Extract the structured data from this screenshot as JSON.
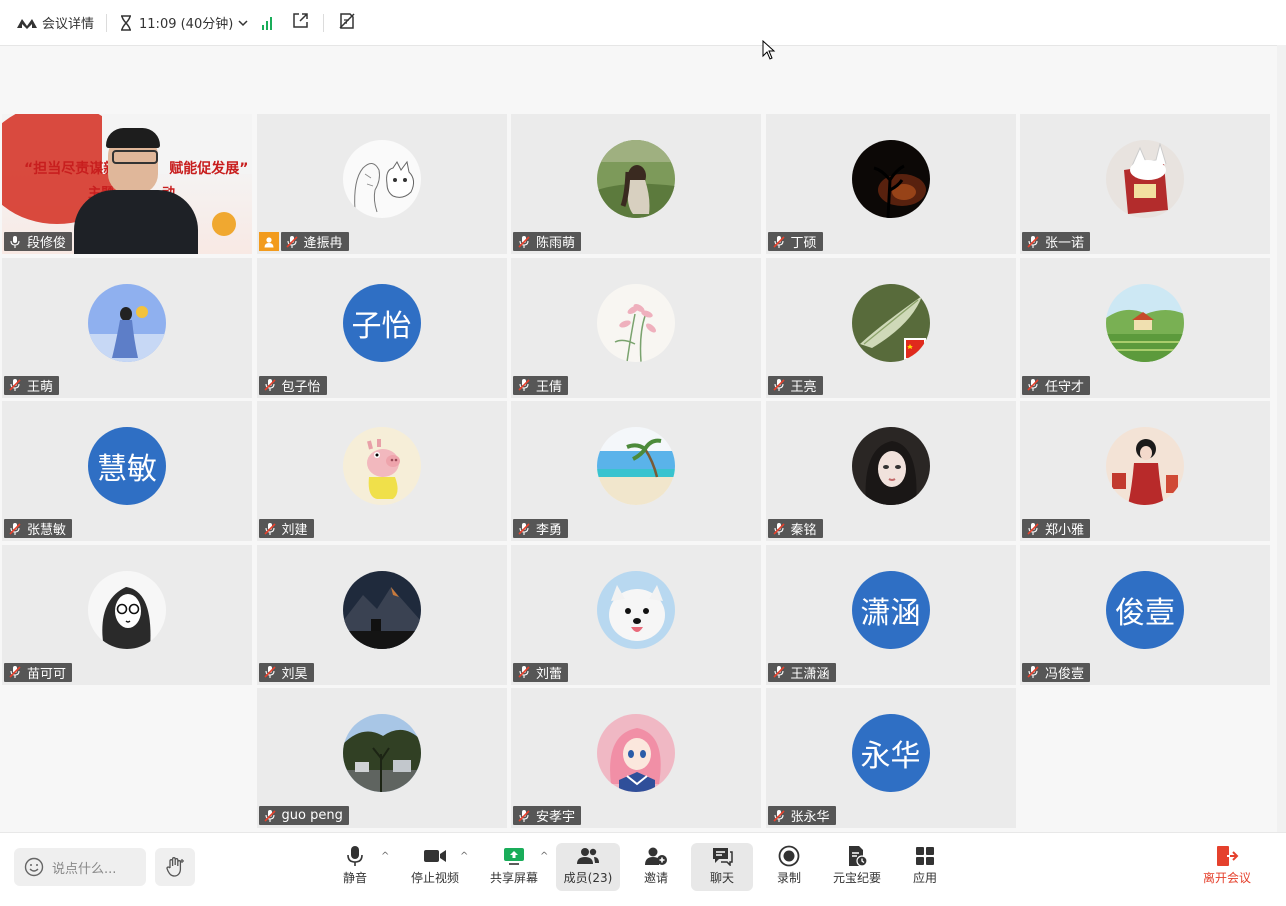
{
  "topbar": {
    "meeting_details": "会议详情",
    "timer": "11:09 (40分钟)"
  },
  "participants": [
    {
      "name": "段修俊",
      "type": "video",
      "row": 0,
      "col": 0,
      "video_text_line1": "“担当尽责谋新",
      "video_text_line1b": "赋能促发展”",
      "video_text_line2": "主题",
      "video_text_line2b": "动"
    },
    {
      "name": "逄振冉",
      "type": "image",
      "row": 0,
      "col": 1,
      "image": "sketch-man-cat",
      "host": true
    },
    {
      "name": "陈雨萌",
      "type": "image",
      "row": 0,
      "col": 2,
      "image": "girl-in-field"
    },
    {
      "name": "丁硕",
      "type": "image",
      "row": 0,
      "col": 3,
      "image": "dark-sunset-tree"
    },
    {
      "name": "张一诺",
      "type": "image",
      "row": 0,
      "col": 4,
      "image": "cat-in-box"
    },
    {
      "name": "王萌",
      "type": "image",
      "row": 1,
      "col": 0,
      "image": "girl-blue-sky"
    },
    {
      "name": "包子怡",
      "type": "text",
      "row": 1,
      "col": 1,
      "initials": "子怡"
    },
    {
      "name": "王倩",
      "type": "image",
      "row": 1,
      "col": 2,
      "image": "pink-lily"
    },
    {
      "name": "王亮",
      "type": "image",
      "row": 1,
      "col": 3,
      "image": "green-leaf-flag"
    },
    {
      "name": "任守才",
      "type": "image",
      "row": 1,
      "col": 4,
      "image": "countryside-house"
    },
    {
      "name": "张慧敏",
      "type": "text",
      "row": 2,
      "col": 0,
      "initials": "慧敏"
    },
    {
      "name": "刘建",
      "type": "image",
      "row": 2,
      "col": 1,
      "image": "cartoon-pig"
    },
    {
      "name": "李勇",
      "type": "image",
      "row": 2,
      "col": 2,
      "image": "beach-palm"
    },
    {
      "name": "秦铭",
      "type": "image",
      "row": 2,
      "col": 3,
      "image": "anime-girl-dark"
    },
    {
      "name": "郑小雅",
      "type": "image",
      "row": 2,
      "col": 4,
      "image": "girl-red-dress"
    },
    {
      "name": "苗可可",
      "type": "image",
      "row": 3,
      "col": 0,
      "image": "sketch-glasses-girl"
    },
    {
      "name": "刘昊",
      "type": "image",
      "row": 3,
      "col": 1,
      "image": "night-mountain"
    },
    {
      "name": "刘蕾",
      "type": "image",
      "row": 3,
      "col": 2,
      "image": "white-dog"
    },
    {
      "name": "王潇涵",
      "type": "text",
      "row": 3,
      "col": 3,
      "initials": "潇涵"
    },
    {
      "name": "冯俊壹",
      "type": "text",
      "row": 3,
      "col": 4,
      "initials": "俊壹"
    },
    {
      "name": "guo peng",
      "type": "image",
      "row": 4,
      "col": 1,
      "image": "trees-street"
    },
    {
      "name": "安孝宇",
      "type": "image",
      "row": 4,
      "col": 2,
      "image": "anime-sailor-girl"
    },
    {
      "name": "张永华",
      "type": "text",
      "row": 4,
      "col": 3,
      "initials": "永华"
    }
  ],
  "bottombar": {
    "chat_placeholder": "说点什么...",
    "mute": "静音",
    "stop_video": "停止视频",
    "share_screen": "共享屏幕",
    "members": "成员(23)",
    "invite": "邀请",
    "chat": "聊天",
    "record": "录制",
    "yuanbao": "元宝纪要",
    "apps": "应用",
    "leave": "离开会议"
  },
  "colors": {
    "accent_blue": "#2f6fc4",
    "share_green": "#1aad5a",
    "leave_red": "#e5412d",
    "signal_green": "#1aad5a"
  }
}
